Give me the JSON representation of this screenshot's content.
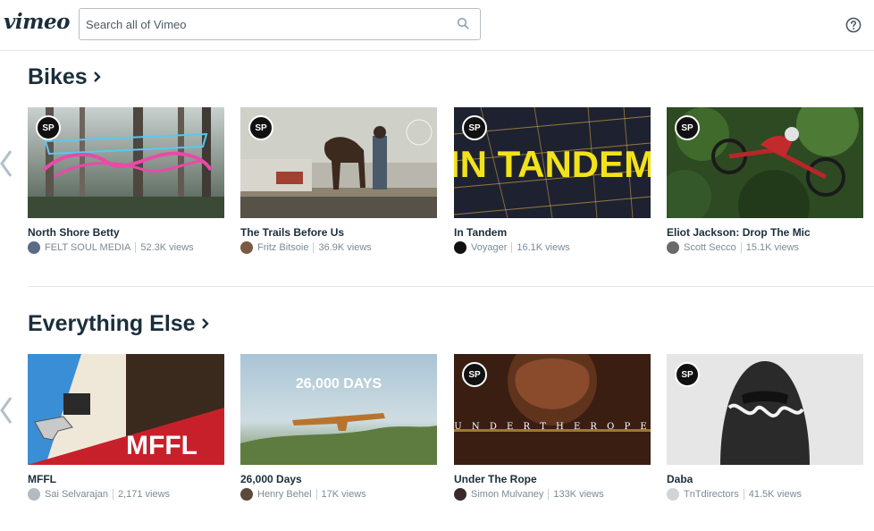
{
  "header": {
    "logo": "vimeo",
    "search_placeholder": "Search all of Vimeo"
  },
  "sections": [
    {
      "title": "Bikes",
      "videos": [
        {
          "title": "North Shore Betty",
          "author": "FELT SOUL MEDIA",
          "views": "52.3K views",
          "staff_pick": "SP"
        },
        {
          "title": "The Trails Before Us",
          "author": "Fritz Bitsoie",
          "views": "36.9K views",
          "staff_pick": "SP"
        },
        {
          "title": "In Tandem",
          "author": "Voyager",
          "views": "16.1K views",
          "staff_pick": "SP",
          "thumb_text": "IN TANDEM"
        },
        {
          "title": "Eliot Jackson: Drop The Mic",
          "author": "Scott Secco",
          "views": "15.1K views",
          "staff_pick": "SP"
        }
      ]
    },
    {
      "title": "Everything Else",
      "videos": [
        {
          "title": "MFFL",
          "author": "Sai Selvarajan",
          "views": "2,171 views",
          "thumb_text": "MFFL"
        },
        {
          "title": "26,000 Days",
          "author": "Henry Behel",
          "views": "17K views",
          "thumb_text": "26,000 DAYS"
        },
        {
          "title": "Under The Rope",
          "author": "Simon Mulvaney",
          "views": "133K views",
          "staff_pick": "SP",
          "thumb_text": "U N D E R  T H E  R O P E"
        },
        {
          "title": "Daba",
          "author": "TnTdirectors",
          "views": "41.5K views",
          "staff_pick": "SP"
        }
      ]
    }
  ]
}
